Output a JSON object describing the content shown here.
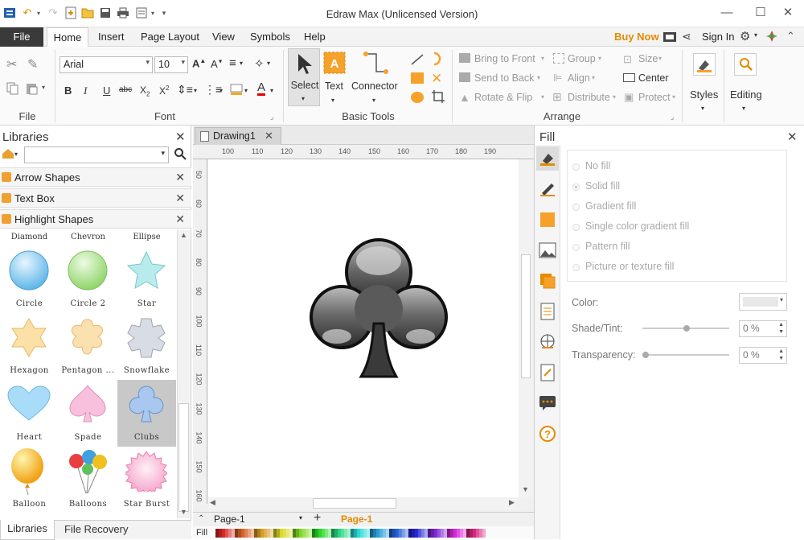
{
  "app": {
    "title": "Edraw Max (Unlicensed Version)"
  },
  "window": {
    "minimize": "—",
    "maximize": "☐",
    "close": "✕"
  },
  "menu": {
    "file": "File",
    "tabs": [
      "Home",
      "Insert",
      "Page Layout",
      "View",
      "Symbols",
      "Help"
    ],
    "buy_now": "Buy Now",
    "sign_in": "Sign In"
  },
  "ribbon": {
    "groups": {
      "file": "File",
      "font": "Font",
      "basic_tools": "Basic Tools",
      "arrange": "Arrange"
    },
    "font_name": "Arial",
    "font_size": "10",
    "select": "Select",
    "text": "Text",
    "connector": "Connector",
    "bring_to_front": "Bring to Front",
    "send_to_back": "Send to Back",
    "rotate_flip": "Rotate & Flip",
    "group": "Group",
    "align": "Align",
    "distribute": "Distribute",
    "size": "Size",
    "center": "Center",
    "protect": "Protect",
    "styles": "Styles",
    "editing": "Editing"
  },
  "libraries": {
    "title": "Libraries",
    "search_placeholder": "",
    "categories": [
      "Arrow Shapes",
      "Text Box",
      "Highlight Shapes"
    ],
    "top_labels": [
      "Diamond",
      "Chevron",
      "Ellipse"
    ],
    "shapes": [
      {
        "label": "Circle"
      },
      {
        "label": "Circle 2"
      },
      {
        "label": "Star"
      },
      {
        "label": "Hexagon"
      },
      {
        "label": "Pentagon ..."
      },
      {
        "label": "Snowflake"
      },
      {
        "label": "Heart"
      },
      {
        "label": "Spade"
      },
      {
        "label": "Clubs"
      },
      {
        "label": "Balloon"
      },
      {
        "label": "Balloons"
      },
      {
        "label": "Star Burst"
      }
    ],
    "bottom_tabs": [
      "Libraries",
      "File Recovery"
    ]
  },
  "canvas": {
    "doc_tab": "Drawing1",
    "ruler_h": [
      "100",
      "110",
      "120",
      "130",
      "140",
      "150",
      "160",
      "170",
      "180",
      "190"
    ],
    "ruler_v": [
      "50",
      "60",
      "70",
      "80",
      "90",
      "100",
      "110",
      "120",
      "130",
      "140",
      "150",
      "160"
    ],
    "page_select": "Page-1",
    "page_tab": "Page-1",
    "fill_label": "Fill"
  },
  "fill_panel": {
    "title": "Fill",
    "options": [
      "No fill",
      "Solid fill",
      "Gradient fill",
      "Single color gradient fill",
      "Pattern fill",
      "Picture or texture fill"
    ],
    "color_label": "Color:",
    "shade_label": "Shade/Tint:",
    "shade_value": "0 %",
    "transparency_label": "Transparency:",
    "transparency_value": "0 %"
  },
  "colors": {
    "accent": "#e58a00",
    "file_tab": "#3a3a3a",
    "selected_shape": "#c8c8c8"
  }
}
